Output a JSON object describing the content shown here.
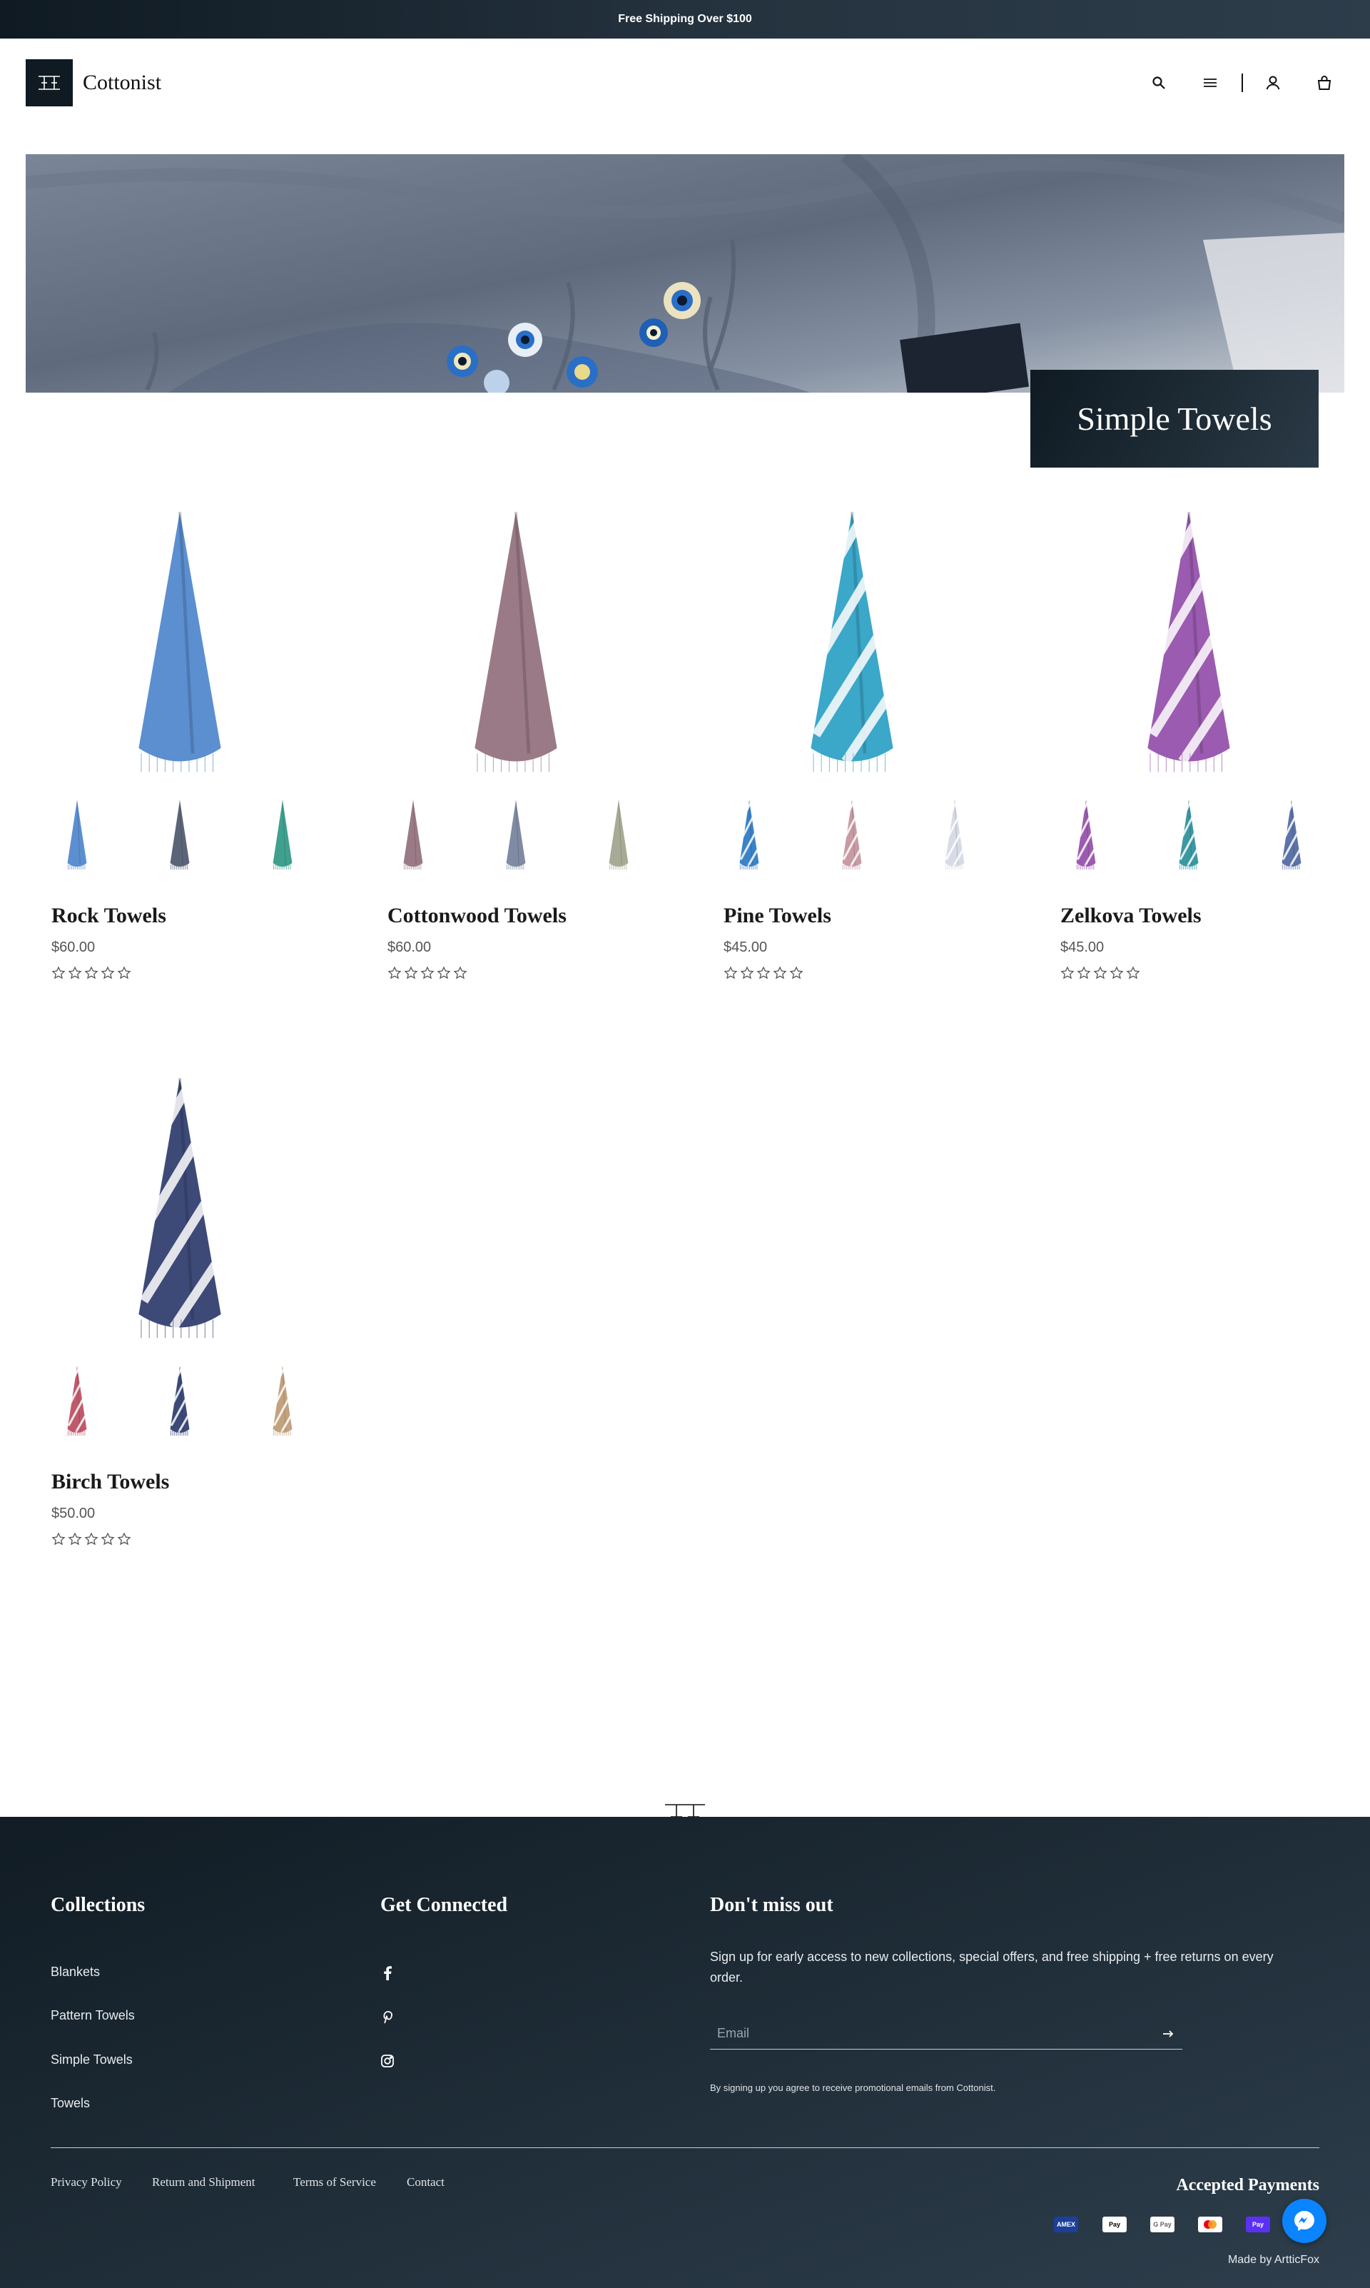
{
  "announcement": {
    "text": "Free Shipping Over $100"
  },
  "header": {
    "brand": "Cottonist",
    "icons": [
      "search-icon",
      "menu-icon",
      "user-icon",
      "bag-icon"
    ]
  },
  "hero": {
    "title": "Simple Towels"
  },
  "products": [
    {
      "name": "Rock Towels",
      "price": "$60.00",
      "rating_stars": 0,
      "main_color": "#5b8fd0",
      "swatches": [
        "#5b8fd0",
        "#5b6578",
        "#3fa08e"
      ]
    },
    {
      "name": "Cottonwood Towels",
      "price": "$60.00",
      "rating_stars": 0,
      "main_color": "#9a7a86",
      "swatches": [
        "#9a7a86",
        "#7f8aa3",
        "#a7ab96"
      ]
    },
    {
      "name": "Pine Towels",
      "price": "$45.00",
      "rating_stars": 0,
      "main_color": "#3ba7c9",
      "swatches": [
        "#3b82c9",
        "#c79aa4",
        "#d7dbe6"
      ]
    },
    {
      "name": "Zelkova Towels",
      "price": "$45.00",
      "rating_stars": 0,
      "main_color": "#9b5bb0",
      "swatches": [
        "#9b5bb0",
        "#3a98a3",
        "#5c72a8"
      ]
    },
    {
      "name": "Birch Towels",
      "price": "$50.00",
      "rating_stars": 0,
      "main_color": "#3d4a78",
      "swatches": [
        "#c05a6a",
        "#3d4a78",
        "#c3a27e"
      ]
    }
  ],
  "footer": {
    "collections_title": "Collections",
    "collections": [
      "Blankets",
      "Pattern Towels",
      "Simple Towels",
      "Towels"
    ],
    "connected_title": "Get Connected",
    "social": [
      "facebook-icon",
      "pinterest-icon",
      "instagram-icon"
    ],
    "newsletter_title": "Don't miss out",
    "newsletter_text": "Sign up for early access to new collections, special offers, and free shipping + free returns on every order.",
    "email_placeholder": "Email",
    "disclaimer": "By signing up you agree to receive promotional emails from Cottonist.",
    "legal_links": [
      "Privacy Policy",
      "Return and Shipment",
      "Terms of Service",
      "Contact"
    ],
    "payments_title": "Accepted Payments",
    "payments": [
      "american-express-icon",
      "apple-pay-icon",
      "google-pay-icon",
      "mastercard-icon",
      "shop-pay-icon"
    ],
    "made_by": "Made by ArtticFox"
  },
  "colors": {
    "dark_navy": "#0f1a22",
    "messenger_blue": "#0a84ff"
  }
}
